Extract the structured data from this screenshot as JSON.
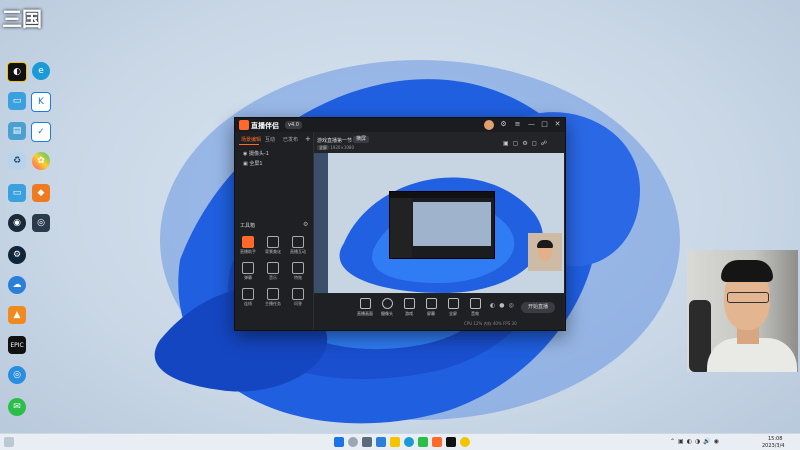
{
  "desktop": {
    "top_left_overlay": "三国"
  },
  "app": {
    "name": "直播伴侣",
    "version": "v4.0",
    "window_controls": [
      "—",
      "□",
      "✕"
    ],
    "sidebar_tabs": [
      "场景编辑",
      "互动",
      "已发布"
    ],
    "scene_items": [
      "摄像头-1",
      "全屏1"
    ],
    "tools_title": "工具箱",
    "tools": [
      "直播助手",
      "背景美化",
      "直播互动",
      "弹幕",
      "音乐",
      "特效",
      "连线",
      "主播任务",
      "问答"
    ],
    "scene_title": "游戏直播第一节",
    "scene_badge": "横屏",
    "scene_tag": "全屏",
    "scene_resolution": "1920×1080",
    "controls": [
      "直播画面",
      "摄像头",
      "游戏",
      "屏幕",
      "全屏",
      "音效"
    ],
    "start_button": "开始直播",
    "stats": "CPU 12%  内存 40%  FPS 30"
  },
  "taskbar": {
    "time": "15:08",
    "date": "2023/3/4"
  }
}
